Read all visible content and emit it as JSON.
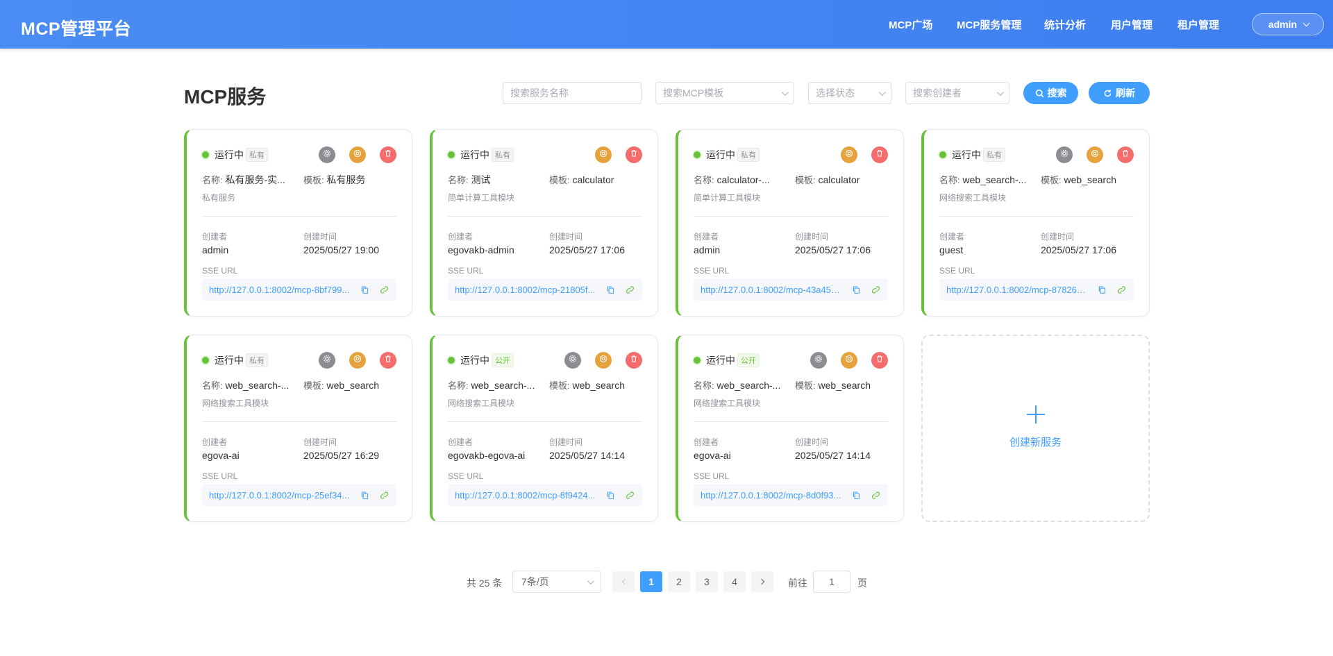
{
  "header": {
    "logo": "MCP管理平台",
    "nav": [
      "MCP广场",
      "MCP服务管理",
      "统计分析",
      "用户管理",
      "租户管理"
    ],
    "user": "admin"
  },
  "toolbar": {
    "title": "MCP服务",
    "search_name_placeholder": "搜索服务名称",
    "search_template_placeholder": "搜索MCP模板",
    "status_placeholder": "选择状态",
    "creator_placeholder": "搜索创建者",
    "search_btn": "搜索",
    "refresh_btn": "刷新"
  },
  "labels": {
    "name": "名称:",
    "template": "模板:",
    "creator": "创建者",
    "created_time": "创建时间",
    "sse_url": "SSE URL"
  },
  "cards": [
    {
      "status": "运行中",
      "visibility": "私有",
      "public": false,
      "has_settings": true,
      "name": "私有服务-实...",
      "template": "私有服务",
      "desc": "私有服务",
      "creator": "admin",
      "time": "2025/05/27 19:00",
      "url": "http://127.0.0.1:8002/mcp-8bf799..."
    },
    {
      "status": "运行中",
      "visibility": "私有",
      "public": false,
      "has_settings": false,
      "name": "测试",
      "template": "calculator",
      "desc": "简单计算工具模块",
      "creator": "egovakb-admin",
      "time": "2025/05/27 17:06",
      "url": "http://127.0.0.1:8002/mcp-21805f..."
    },
    {
      "status": "运行中",
      "visibility": "私有",
      "public": false,
      "has_settings": false,
      "name": "calculator-...",
      "template": "calculator",
      "desc": "简单计算工具模块",
      "creator": "admin",
      "time": "2025/05/27 17:06",
      "url": "http://127.0.0.1:8002/mcp-43a459..."
    },
    {
      "status": "运行中",
      "visibility": "私有",
      "public": false,
      "has_settings": true,
      "name": "web_search-...",
      "template": "web_search",
      "desc": "网络搜索工具模块",
      "creator": "guest",
      "time": "2025/05/27 17:06",
      "url": "http://127.0.0.1:8002/mcp-878263..."
    },
    {
      "status": "运行中",
      "visibility": "私有",
      "public": false,
      "has_settings": true,
      "name": "web_search-...",
      "template": "web_search",
      "desc": "网络搜索工具模块",
      "creator": "egova-ai",
      "time": "2025/05/27 16:29",
      "url": "http://127.0.0.1:8002/mcp-25ef34..."
    },
    {
      "status": "运行中",
      "visibility": "公开",
      "public": true,
      "has_settings": true,
      "name": "web_search-...",
      "template": "web_search",
      "desc": "网络搜索工具模块",
      "creator": "egovakb-egova-ai",
      "time": "2025/05/27 14:14",
      "url": "http://127.0.0.1:8002/mcp-8f9424..."
    },
    {
      "status": "运行中",
      "visibility": "公开",
      "public": true,
      "has_settings": true,
      "name": "web_search-...",
      "template": "web_search",
      "desc": "网络搜索工具模块",
      "creator": "egova-ai",
      "time": "2025/05/27 14:14",
      "url": "http://127.0.0.1:8002/mcp-8d0f93..."
    }
  ],
  "create_card": {
    "label": "创建新服务"
  },
  "pagination": {
    "total": "共 25 条",
    "page_size": "7条/页",
    "pages": [
      "1",
      "2",
      "3",
      "4"
    ],
    "current": "1",
    "goto_prefix": "前往",
    "goto_value": "1",
    "goto_suffix": "页"
  },
  "colors": {
    "header": "#4a8cf3",
    "primary": "#409eff",
    "running": "#67c23a",
    "stop": "#e6a23c",
    "delete": "#f56c6c"
  }
}
